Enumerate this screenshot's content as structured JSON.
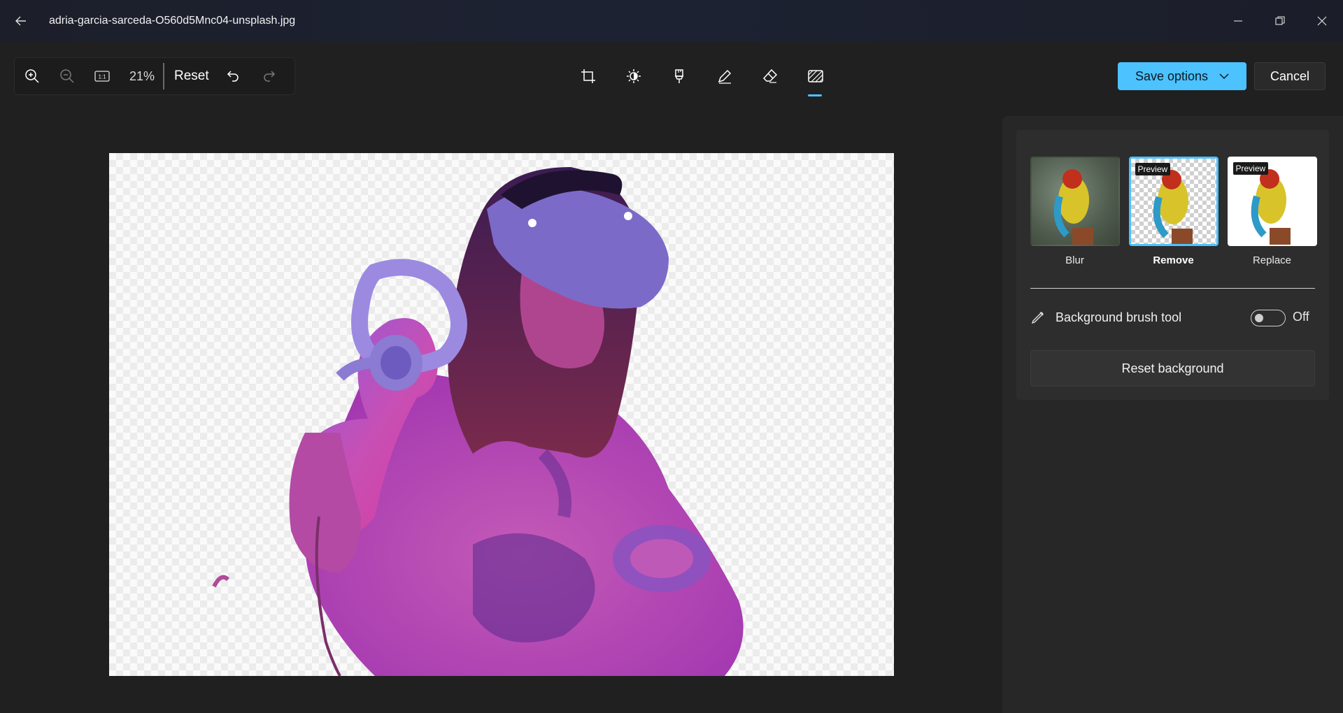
{
  "titlebar": {
    "file_name": "adria-garcia-sarceda-O560d5Mnc04-unsplash.jpg",
    "back_icon": "back-arrow-icon",
    "minimize_icon": "minimize-icon",
    "restore_icon": "restore-icon",
    "close_icon": "close-icon"
  },
  "zoom_toolbar": {
    "zoom_in_icon": "zoom-in-icon",
    "zoom_out_icon": "zoom-out-icon",
    "actual_size_label": "1:1",
    "zoom_level": "21%",
    "reset_label": "Reset",
    "undo_icon": "undo-icon",
    "redo_icon": "redo-icon"
  },
  "edit_tools": [
    {
      "name": "crop",
      "icon": "crop-icon",
      "active": false
    },
    {
      "name": "adjustment",
      "icon": "brightness-icon",
      "active": false
    },
    {
      "name": "filter",
      "icon": "filter-icon",
      "active": false
    },
    {
      "name": "markup",
      "icon": "pen-icon",
      "active": false
    },
    {
      "name": "erase",
      "icon": "eraser-icon",
      "active": false
    },
    {
      "name": "background",
      "icon": "background-icon",
      "active": true
    }
  ],
  "actions": {
    "save_label": "Save options",
    "cancel_label": "Cancel"
  },
  "background_panel": {
    "options": [
      {
        "label": "Blur",
        "badge": "",
        "selected": false
      },
      {
        "label": "Remove",
        "badge": "Preview",
        "selected": true
      },
      {
        "label": "Replace",
        "badge": "Preview",
        "selected": false
      }
    ],
    "brush_tool_label": "Background brush tool",
    "brush_tool_state": "Off",
    "reset_label": "Reset background"
  },
  "colors": {
    "accent": "#4cc2ff",
    "background": "#202020",
    "panel": "#272727"
  }
}
